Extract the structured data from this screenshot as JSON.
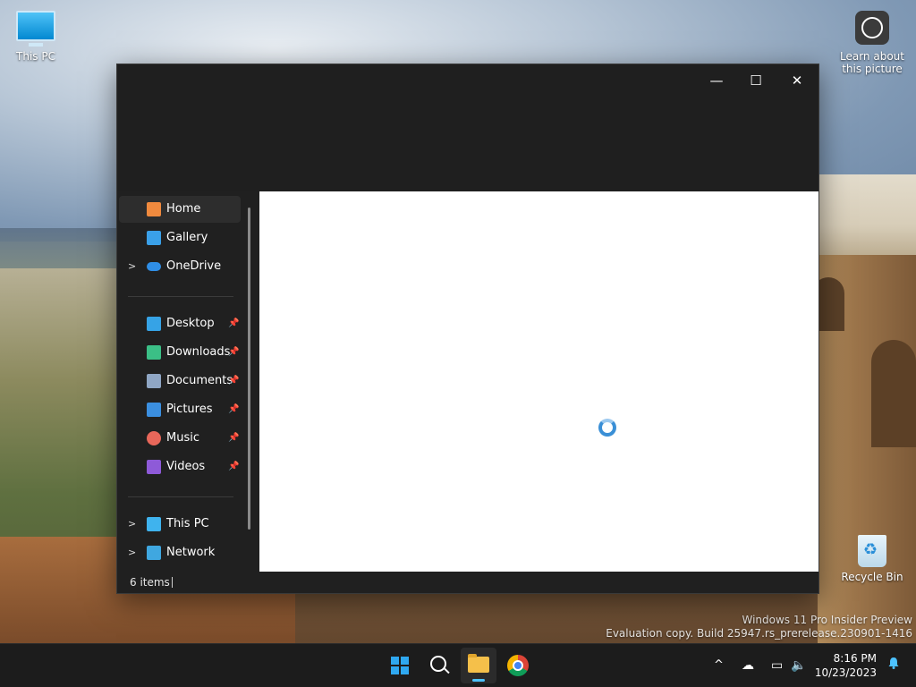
{
  "desktop": {
    "icons": {
      "this_pc": "This PC",
      "learn_line1": "Learn about",
      "learn_line2": "this picture",
      "recycle_bin": "Recycle Bin"
    },
    "watermark": {
      "line1": "Windows 11 Pro Insider Preview",
      "line2": "Evaluation copy. Build 25947.rs_prerelease.230901-1416"
    }
  },
  "window": {
    "controls": {
      "minimize": "—",
      "maximize": "☐",
      "close": "✕"
    },
    "nav": {
      "top": [
        {
          "label": "Home",
          "icon": "home-icon",
          "color": "#f08a3e"
        },
        {
          "label": "Gallery",
          "icon": "gallery-icon",
          "color": "#3aa0e8"
        },
        {
          "label": "OneDrive",
          "icon": "onedrive-icon",
          "color": "#2f8ee6"
        }
      ],
      "pinned": [
        {
          "label": "Desktop",
          "icon": "desktop-icon",
          "color": "#36a3e6"
        },
        {
          "label": "Downloads",
          "icon": "downloads-icon",
          "color": "#3bbf86"
        },
        {
          "label": "Documents",
          "icon": "documents-icon",
          "color": "#8fa6c4"
        },
        {
          "label": "Pictures",
          "icon": "pictures-icon",
          "color": "#3b8fe0"
        },
        {
          "label": "Music",
          "icon": "music-icon",
          "color": "#e8675a"
        },
        {
          "label": "Videos",
          "icon": "videos-icon",
          "color": "#8e5ad8"
        }
      ],
      "bottom": [
        {
          "label": "This PC",
          "icon": "this-pc-icon",
          "color": "#3fb3ee"
        },
        {
          "label": "Network",
          "icon": "network-icon",
          "color": "#3fa7e0"
        }
      ]
    },
    "status": "6 items"
  },
  "taskbar": {
    "time": "8:16 PM",
    "date": "10/23/2023",
    "tray_chevron": "^"
  }
}
